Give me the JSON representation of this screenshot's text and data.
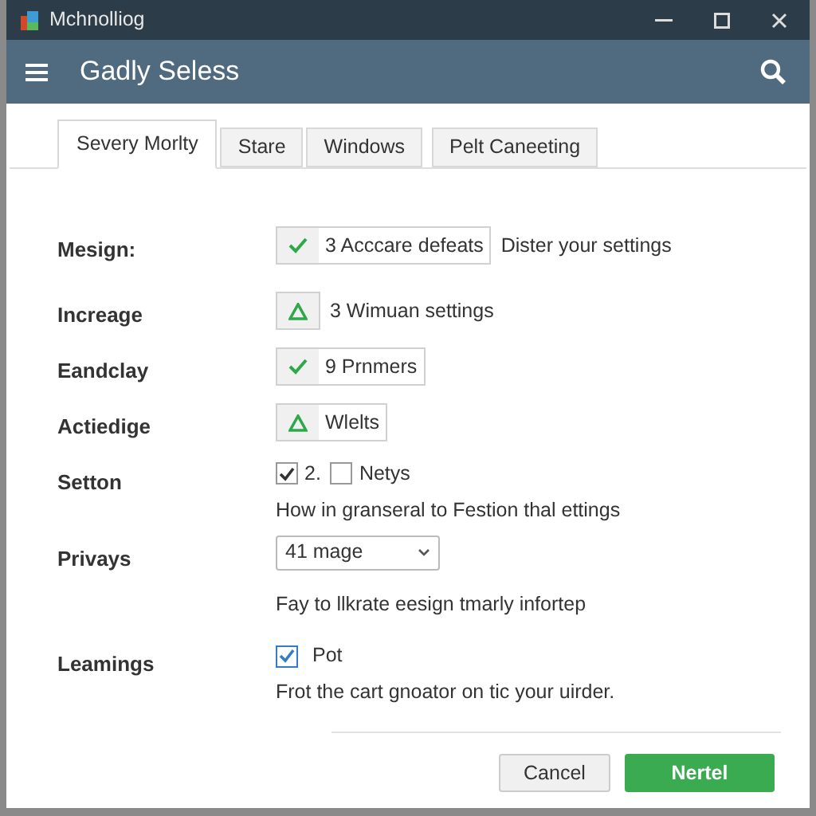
{
  "window": {
    "title": "Mchnolliog"
  },
  "header": {
    "title": "Gadly Seless"
  },
  "tabs": [
    {
      "label": "Severy Morlty",
      "selected": true
    },
    {
      "label": "Stare",
      "selected": false
    },
    {
      "label": "Windows",
      "selected": false
    },
    {
      "label": "Pelt Caneeting",
      "selected": false
    }
  ],
  "rows": [
    {
      "label": "Mesign:",
      "kind": "confirmed",
      "value": "3 Acccare defeats",
      "note": "Dister your settings"
    },
    {
      "label": "Increage",
      "kind": "warning",
      "note": "3 Wimuan settings"
    },
    {
      "label": "Eandclay",
      "kind": "confirmed",
      "value": "9 Prnmers"
    },
    {
      "label": "Actiedige",
      "kind": "warning",
      "value": "Wlelts"
    },
    {
      "label": "Setton",
      "kind": "checkboxes",
      "options": [
        {
          "label": "2.",
          "checked": true
        },
        {
          "label": "Netys",
          "checked": false
        }
      ],
      "description": "How in granseral to Festion thal ettings"
    },
    {
      "label": "Privays",
      "kind": "select",
      "value": "41 mage",
      "description": "Fay to llkrate eesign tmarly infortep"
    },
    {
      "label": "Leamings",
      "kind": "checkbox",
      "checked": true,
      "option": "Pot",
      "description": "Frot the cart gnoator on tic your uirder."
    }
  ],
  "buttons": [
    {
      "label": "Cancel",
      "kind": "secondary"
    },
    {
      "label": "Nertel",
      "kind": "primary"
    }
  ]
}
